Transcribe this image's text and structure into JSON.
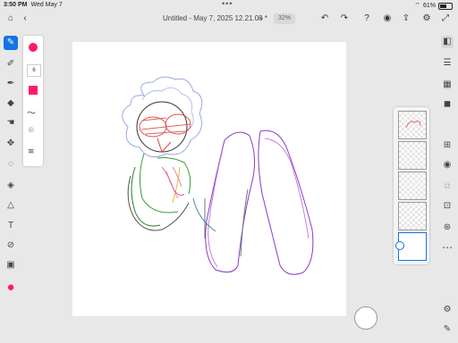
{
  "status": {
    "time": "3:50 PM",
    "date": "Wed May 7",
    "battery": "61%",
    "battery_level": 0.61,
    "dots": "•••"
  },
  "topbar": {
    "title": "Untitled - May 7, 2025 12.21.08 *",
    "chevron": "⌄",
    "zoom": "32%"
  },
  "topbar_icons": [
    "undo-icon",
    "redo-icon",
    "help-icon",
    "profile-icon",
    "share-icon",
    "gear-icon",
    "fullscreen-icon"
  ],
  "left_tools": [
    "brush-tool-icon",
    "pencil-icon",
    "marker-icon",
    "eraser-icon",
    "smudge-icon",
    "move-icon",
    "lasso-icon",
    "fill-icon",
    "shape-icon",
    "text-icon",
    "eyedropper-icon",
    "image-icon"
  ],
  "brush_panel": {
    "size_value": "6"
  },
  "colors": {
    "primary": "#ff1a6c",
    "accent": "#1473e6"
  },
  "right_tools": [
    "layers-icon",
    "adjust-icon",
    "properties-icon",
    "comment-icon",
    "add-layer-icon",
    "visibility-icon",
    "duplicate-icon",
    "mask-icon",
    "more-icon",
    "settings-icon",
    "edit-icon"
  ]
}
